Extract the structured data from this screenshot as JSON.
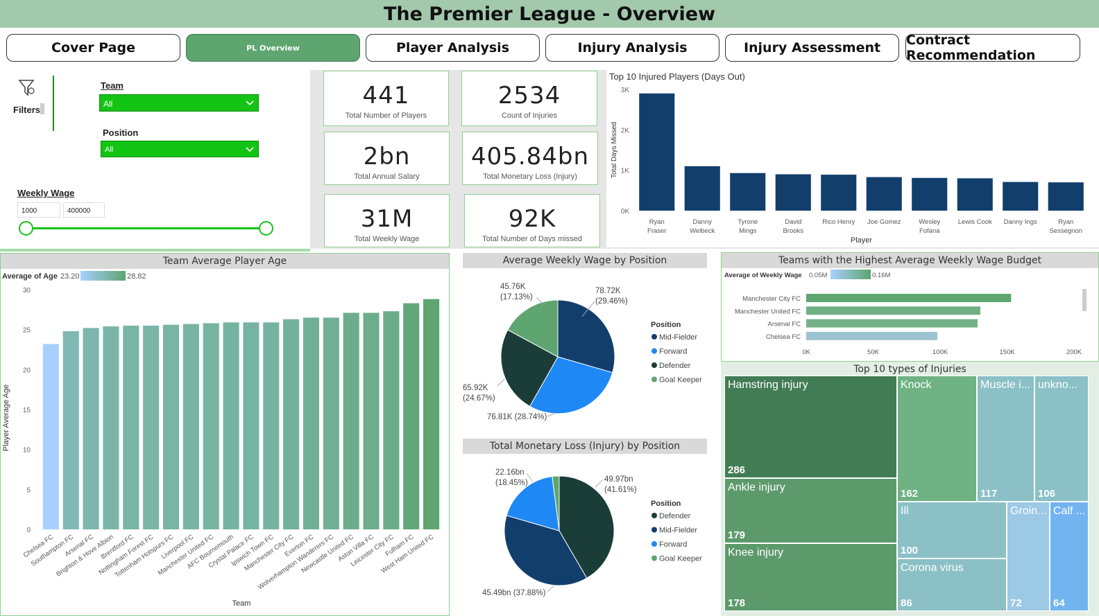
{
  "title": "The Premier League - Overview",
  "nav": [
    {
      "label": "Cover Page"
    },
    {
      "label": "PL Overview"
    },
    {
      "label": "Player Analysis"
    },
    {
      "label": "Injury Analysis"
    },
    {
      "label": "Injury Assessment"
    },
    {
      "label": "Contract Recommendation"
    }
  ],
  "filters": {
    "label": "Filters",
    "team_label": "Team",
    "team_value": "All",
    "position_label": "Position",
    "position_value": "All",
    "wage_label": "Weekly Wage",
    "wage_min": "1000",
    "wage_max": "400000"
  },
  "kpis": [
    {
      "value": "441",
      "label": "Total Number of Players"
    },
    {
      "value": "2534",
      "label": "Count of Injuries"
    },
    {
      "value": "2bn",
      "label": "Total Annual Salary"
    },
    {
      "value": "405.84bn",
      "label": "Total Monetary Loss (Injury)"
    },
    {
      "value": "31M",
      "label": "Total Weekly Wage"
    },
    {
      "value": "92K",
      "label": "Total Number of Days missed"
    }
  ],
  "colors": {
    "accent": "#5ea56f",
    "navy": "#123e6c",
    "bright_green": "#14c414"
  },
  "chart_data": [
    {
      "type": "bar",
      "title": "Top 10 Injured Players (Days Out)",
      "xlabel": "Player",
      "ylabel": "Total Days Missed",
      "ylim": [
        0,
        3000
      ],
      "yticks": [
        "0K",
        "1K",
        "2K",
        "3K"
      ],
      "categories": [
        "Ryan Fraser",
        "Danny Welbeck",
        "Tyrone Mings",
        "David Brooks",
        "Rico Henry",
        "Joe Gomez",
        "Wesley Fofana",
        "Lewis Cook",
        "Danny Ings",
        "Ryan Sessegnon"
      ],
      "values": [
        2900,
        1100,
        930,
        900,
        890,
        830,
        810,
        800,
        710,
        700
      ]
    },
    {
      "type": "bar",
      "title": "Team Average Player Age",
      "xlabel": "Team",
      "ylabel": "Player Average Age",
      "legend_title": "Average of Age",
      "legend_min": "23.20",
      "legend_max": "28.82",
      "ylim": [
        0,
        30
      ],
      "yticks": [
        "0",
        "5",
        "10",
        "15",
        "20",
        "25",
        "30"
      ],
      "categories": [
        "Chelsea FC",
        "Southampton FC",
        "Arsenal FC",
        "Brighton & Hove Albion",
        "Brentford FC",
        "Nottingham Forest FC",
        "Tottenham Hotspurs FC",
        "Liverpool FC",
        "Manchester United FC",
        "AFC Bournemouth",
        "Crystal Palace FC",
        "Ipswich Town FC",
        "Manchester City FC",
        "Everton FC",
        "Wolverhampton Wanderers FC",
        "Newcastle United FC",
        "Aston Villa FC",
        "Leicester City FC",
        "Fulham FC",
        "West Ham United FC"
      ],
      "values": [
        23.2,
        24.8,
        25.2,
        25.4,
        25.5,
        25.5,
        25.6,
        25.7,
        25.8,
        25.9,
        25.9,
        25.9,
        26.3,
        26.5,
        26.5,
        27.1,
        27.1,
        27.3,
        28.3,
        28.82
      ]
    },
    {
      "type": "pie",
      "title": "Average Weekly Wage by Position",
      "legend_title": "Position",
      "series": [
        {
          "name": "Mid-Fielder",
          "value": 78720,
          "label": "78.72K",
          "pct": "(29.46%)",
          "color": "#123e6c"
        },
        {
          "name": "Forward",
          "value": 76810,
          "label": "76.81K (28.74%)",
          "pct": "",
          "color": "#1e88f5"
        },
        {
          "name": "Defender",
          "value": 65920,
          "label": "65.92K",
          "pct": "(24.67%)",
          "color": "#1b3d38"
        },
        {
          "name": "Goal Keeper",
          "value": 45760,
          "label": "45.76K",
          "pct": "(17.13%)",
          "color": "#5ea56f"
        }
      ]
    },
    {
      "type": "pie",
      "title": "Total Monetary Loss (Injury) by Position",
      "legend_title": "Position",
      "series": [
        {
          "name": "Defender",
          "value": 49.97,
          "label": "49.97bn",
          "pct": "(41.61%)",
          "color": "#1b3d38"
        },
        {
          "name": "Mid-Fielder",
          "value": 45.49,
          "label": "45.49bn (37.88%)",
          "pct": "",
          "color": "#123e6c"
        },
        {
          "name": "Forward",
          "value": 22.16,
          "label": "22.16bn",
          "pct": "(18.45%)",
          "color": "#1e88f5"
        },
        {
          "name": "Goal Keeper",
          "value": 2.45,
          "label": "",
          "pct": "",
          "color": "#5ea56f"
        }
      ]
    },
    {
      "type": "bar",
      "orientation": "horizontal",
      "title": "Teams with the Highest Average Weekly Wage Budget",
      "legend_title": "Average of Weekly Wage",
      "legend_min": "0.05M",
      "legend_max": "0.16M",
      "xlim": [
        0,
        200000
      ],
      "xticks": [
        "0K",
        "50K",
        "100K",
        "150K",
        "200K"
      ],
      "categories": [
        "Manchester City FC",
        "Manchester United FC",
        "Arsenal FC",
        "Chelsea FC"
      ],
      "values": [
        153000,
        130000,
        128000,
        98000
      ]
    },
    {
      "type": "treemap",
      "title": "Top 10 types of Injuries",
      "items": [
        {
          "name": "Hamstring injury",
          "value": 286
        },
        {
          "name": "Ankle injury",
          "value": 179
        },
        {
          "name": "Knee injury",
          "value": 178
        },
        {
          "name": "Knock",
          "value": 162
        },
        {
          "name": "Muscle i...",
          "value": 117
        },
        {
          "name": "unkno...",
          "value": 106
        },
        {
          "name": "Ill",
          "value": 100
        },
        {
          "name": "Corona virus",
          "value": 86
        },
        {
          "name": "Groin...",
          "value": 72
        },
        {
          "name": "Calf ...",
          "value": 64
        }
      ]
    }
  ]
}
